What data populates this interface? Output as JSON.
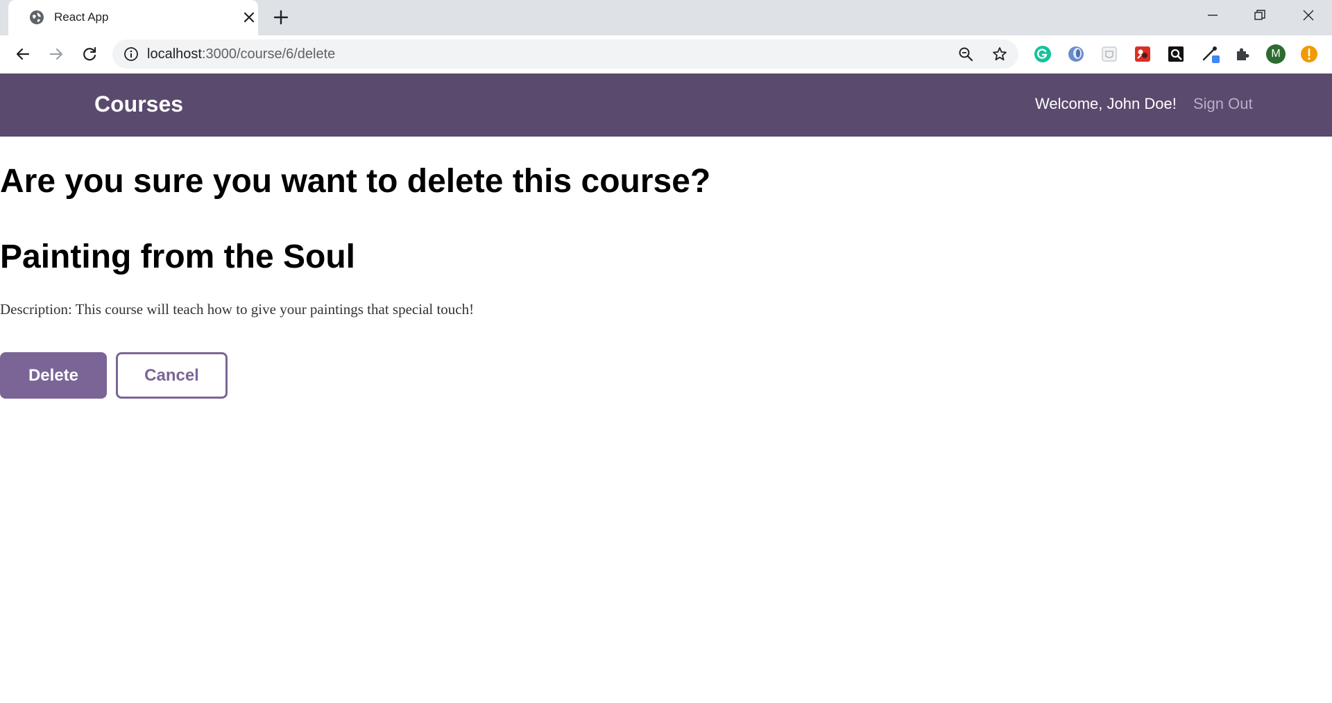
{
  "browser": {
    "tab_title": "React App",
    "url_host": "localhost",
    "url_rest": ":3000/course/6/delete",
    "icons": [
      "globe-icon",
      "close-icon",
      "plus-icon",
      "minimize-icon",
      "restore-icon",
      "close-window-icon",
      "back-icon",
      "forward-icon",
      "reload-icon",
      "info-icon",
      "zoom-out-icon",
      "star-icon",
      "grammarly-icon",
      "extension-icon",
      "puzzle-icon",
      "alert-icon"
    ],
    "profile_initial": "M"
  },
  "header": {
    "brand": "Courses",
    "welcome": "Welcome, John Doe!",
    "sign_out": "Sign Out",
    "background_color": "#5a4a6d"
  },
  "main": {
    "confirm_heading": "Are you sure you want to delete this course?",
    "course_title": "Painting from the Soul",
    "description": "Description: This course will teach how to give your paintings that special touch!",
    "delete_label": "Delete",
    "cancel_label": "Cancel",
    "accent_color": "#7b6597"
  }
}
